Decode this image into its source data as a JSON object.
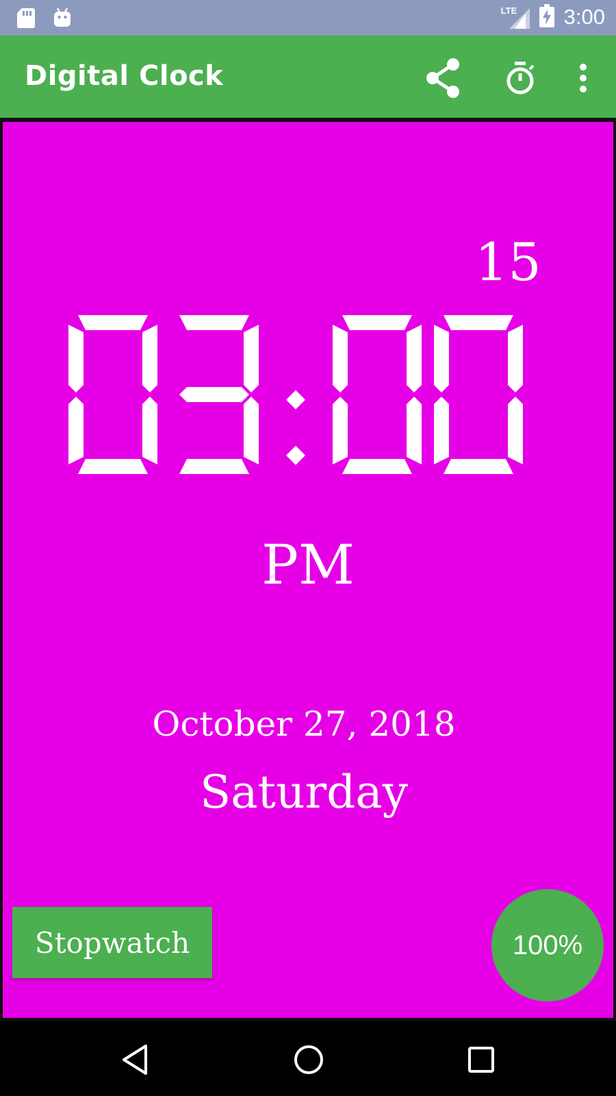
{
  "status_bar": {
    "left_icons": [
      "sd-card-icon",
      "android-icon"
    ],
    "network_label": "LTE",
    "time": "3:00"
  },
  "app_bar": {
    "title": "Digital Clock",
    "actions": [
      "share-icon",
      "timer-icon",
      "more-vert-icon"
    ]
  },
  "clock": {
    "seconds": "15",
    "hour_minute": "03:00",
    "ampm": "PM",
    "date": "October 27, 2018",
    "day": "Saturday"
  },
  "controls": {
    "stopwatch_label": "Stopwatch",
    "battery_label": "100%"
  },
  "navigation": {
    "buttons": [
      "back-icon",
      "home-icon",
      "recents-icon"
    ]
  },
  "colors": {
    "status_bar": "#8c9bbd",
    "app_bar": "#4caf50",
    "clock_background": "#e600e6",
    "accent_green": "#4caf50",
    "text": "#ffffff"
  }
}
